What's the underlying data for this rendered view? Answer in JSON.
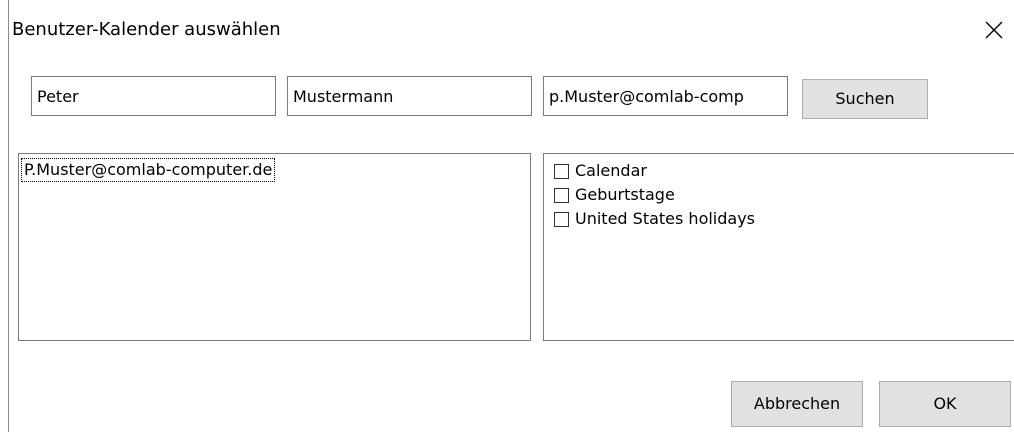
{
  "dialog": {
    "title": "Benutzer-Kalender auswählen",
    "close_icon": "close-icon"
  },
  "search": {
    "first_name": "Peter",
    "last_name": "Mustermann",
    "email": "p.Muster@comlab-comp",
    "search_button": "Suchen"
  },
  "users": {
    "items": [
      {
        "label": "P.Muster@comlab-computer.de",
        "focused": true
      }
    ]
  },
  "calendars": {
    "items": [
      {
        "label": "Calendar",
        "checked": false
      },
      {
        "label": "Geburtstage",
        "checked": false
      },
      {
        "label": "United States holidays",
        "checked": false
      }
    ]
  },
  "footer": {
    "cancel_button": "Abbrechen",
    "ok_button": "OK"
  }
}
